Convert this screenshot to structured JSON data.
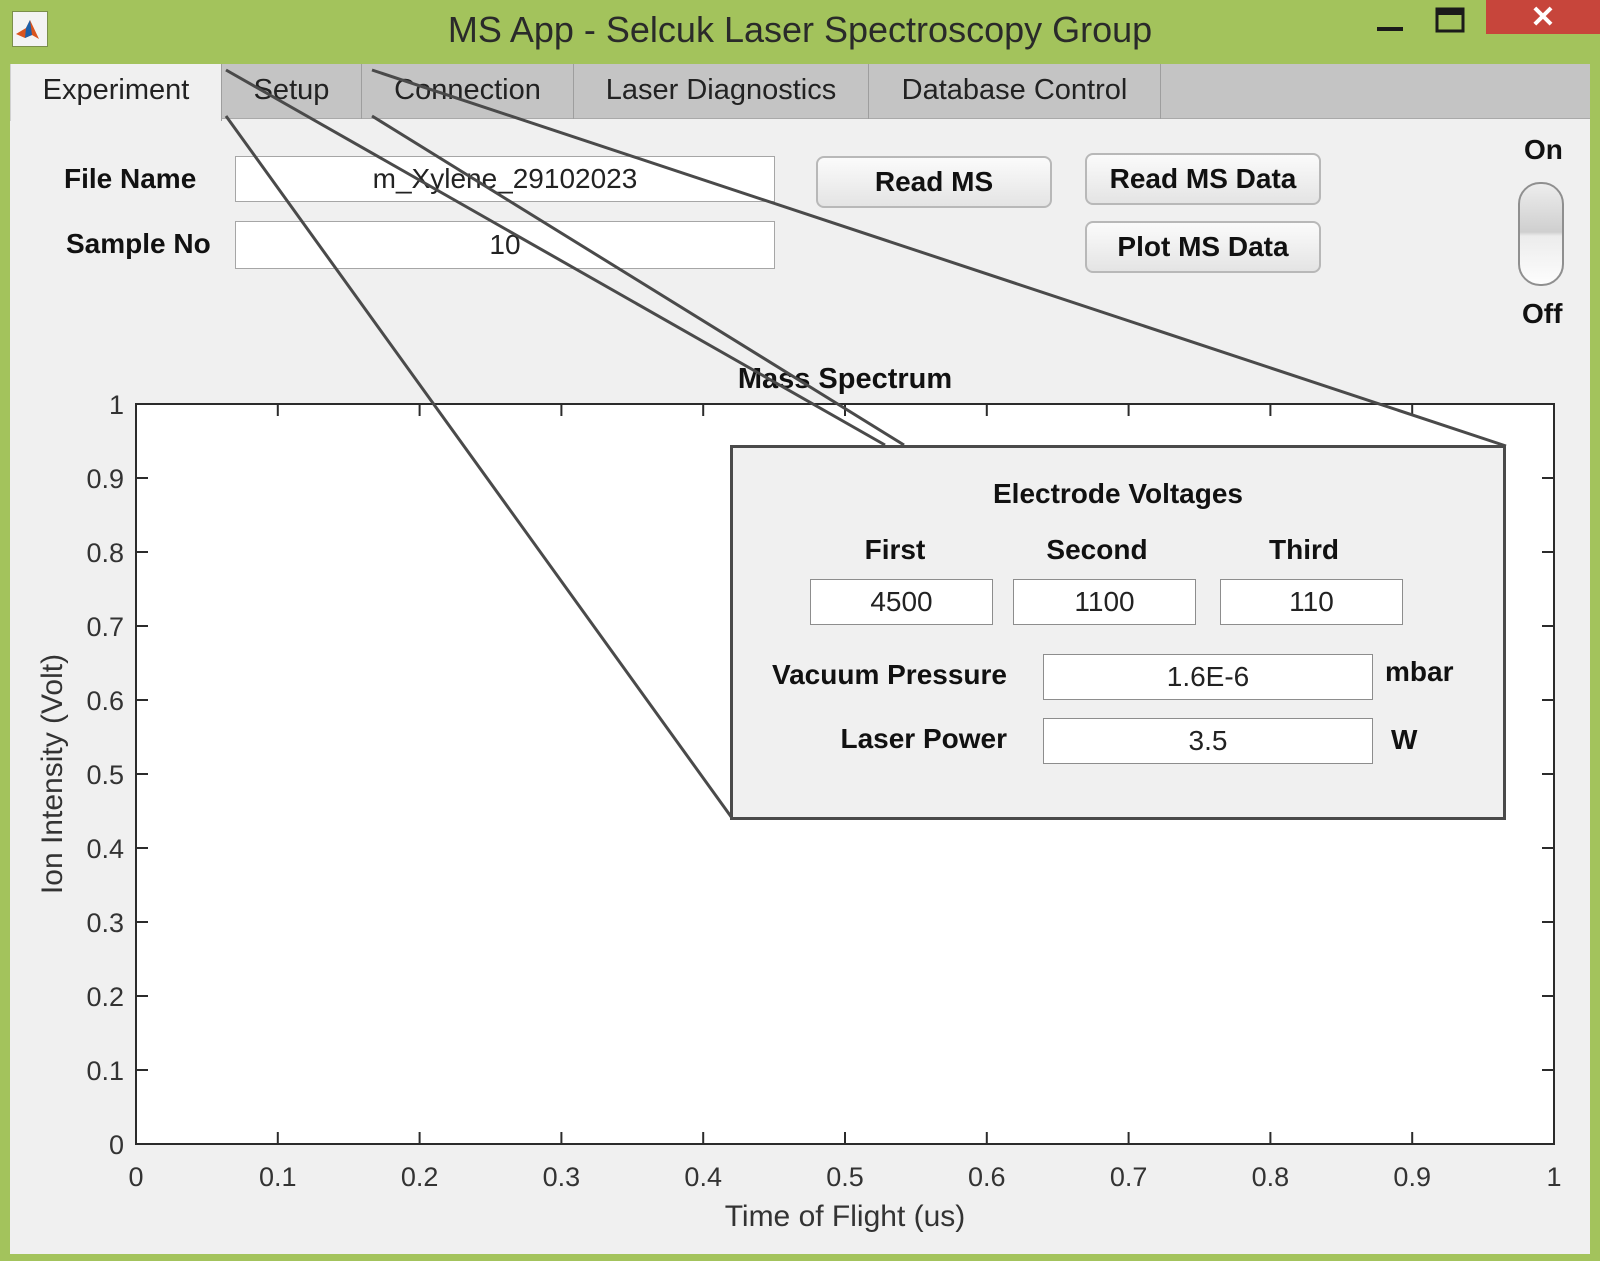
{
  "window": {
    "title": "MS App - Selcuk Laser Spectroscopy Group",
    "controls": {
      "minimize": "—",
      "maximize": "□",
      "close": "✕"
    }
  },
  "tabs": [
    {
      "label": "Experiment",
      "active": true
    },
    {
      "label": "Setup"
    },
    {
      "label": "Connection"
    },
    {
      "label": "Laser Diagnostics"
    },
    {
      "label": "Database Control"
    }
  ],
  "experiment": {
    "file_name_label": "File Name",
    "file_name_value": "m_Xylene_29102023",
    "sample_no_label": "Sample No",
    "sample_no_value": "10",
    "read_ms_button": "Read MS",
    "read_ms_data_button": "Read MS Data",
    "plot_ms_data_button": "Plot MS Data",
    "switch_on_label": "On",
    "switch_off_label": "Off"
  },
  "chart_data": {
    "type": "line",
    "title": "Mass Spectrum",
    "xlabel": "Time of Flight (us)",
    "ylabel": "Ion Intensity (Volt)",
    "xlim": [
      0,
      1
    ],
    "ylim": [
      0,
      1
    ],
    "xticks": [
      "0",
      "0.1",
      "0.2",
      "0.3",
      "0.4",
      "0.5",
      "0.6",
      "0.7",
      "0.8",
      "0.9",
      "1"
    ],
    "yticks": [
      "0",
      "0.1",
      "0.2",
      "0.3",
      "0.4",
      "0.5",
      "0.6",
      "0.7",
      "0.8",
      "0.9",
      "1"
    ],
    "grid": false,
    "series": []
  },
  "setup_callout": {
    "title": "Electrode Voltages",
    "first_label": "First",
    "second_label": "Second",
    "third_label": "Third",
    "first_value": "4500",
    "second_value": "1100",
    "third_value": "110",
    "vacuum_label": "Vacuum Pressure",
    "vacuum_value": "1.6E-6",
    "vacuum_unit": "mbar",
    "laser_label": "Laser Power",
    "laser_value": "3.5",
    "laser_unit": "W"
  },
  "colors": {
    "window_frame": "#a3c35c",
    "close_button": "#c7453b",
    "panel": "#f0f0f0",
    "callout_border": "#4a4a4a"
  }
}
